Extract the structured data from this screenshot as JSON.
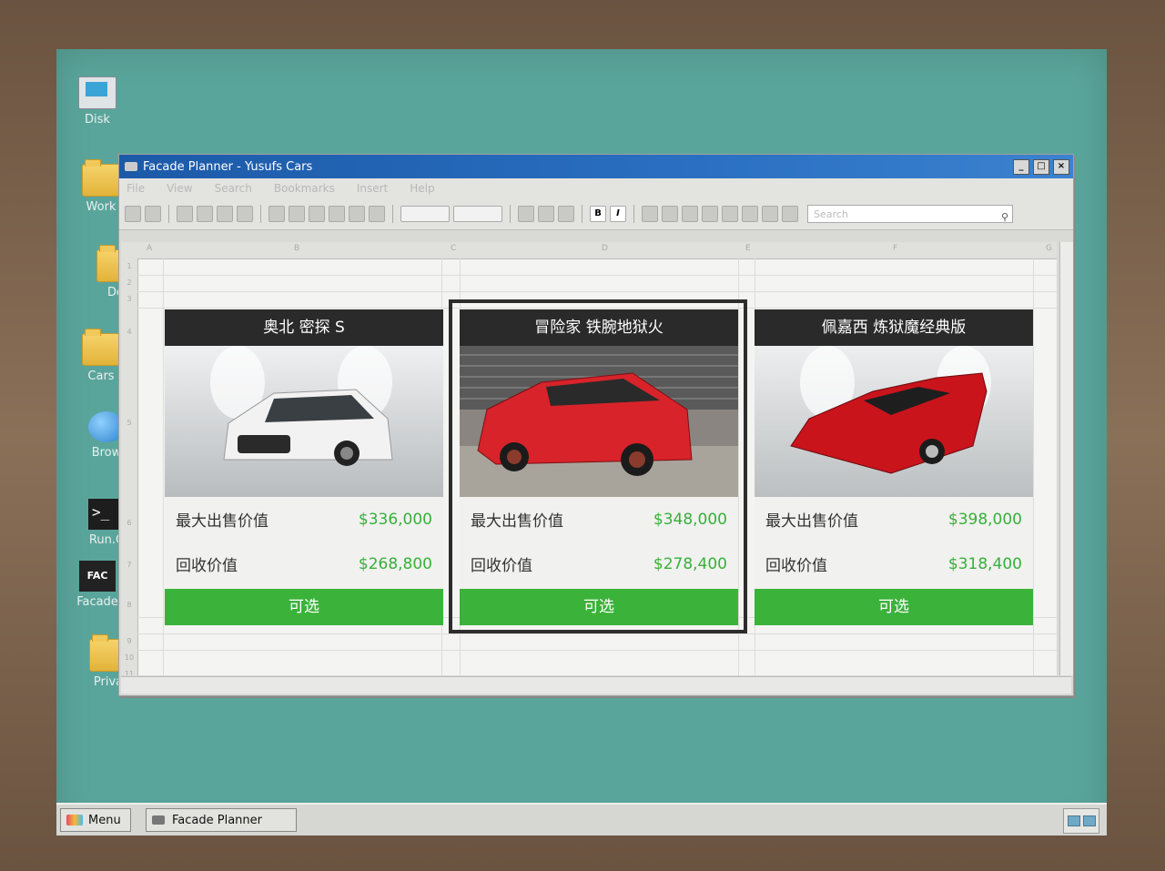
{
  "desktop": {
    "icons": [
      {
        "label": "Disk",
        "icon": "computer-icon"
      },
      {
        "label": "Work",
        "icon": "folder-icon"
      },
      {
        "label": "Do",
        "icon": "folder-icon"
      },
      {
        "label": "Cars",
        "icon": "folder-icon"
      },
      {
        "label": "Brow",
        "icon": "globe-icon"
      },
      {
        "label": "Run.C",
        "icon": "terminal-icon"
      },
      {
        "label": "Facade",
        "icon": "facade-icon"
      },
      {
        "label": "Priva",
        "icon": "folder-icon"
      }
    ],
    "terminal_glyph": ">_",
    "facade_glyph": "FAC"
  },
  "window": {
    "title": "Facade Planner - Yusufs Cars",
    "menu": [
      "File",
      "View",
      "Search",
      "Bookmarks",
      "Insert",
      "Help"
    ],
    "toolbar": {
      "bold_label": "B",
      "italic_label": "I",
      "search_placeholder": "Search"
    },
    "column_headers": [
      "A",
      "B",
      "C",
      "D",
      "E",
      "F",
      "G"
    ],
    "row_headers": [
      "1",
      "2",
      "3",
      "4",
      "5",
      "6",
      "7",
      "8",
      "9",
      "10",
      "11"
    ]
  },
  "cards": [
    {
      "name": "奥北 密探 S",
      "max_sale_label": "最大出售价值",
      "max_sale_value": "$336,000",
      "trade_in_label": "回收价值",
      "trade_in_value": "$268,800",
      "status": "可选",
      "car_color": "#f2f2f2"
    },
    {
      "name": "冒险家 铁腕地狱火",
      "max_sale_label": "最大出售价值",
      "max_sale_value": "$348,000",
      "trade_in_label": "回收价值",
      "trade_in_value": "$278,400",
      "status": "可选",
      "car_color": "#d8232a"
    },
    {
      "name": "佩嘉西 炼狱魔经典版",
      "max_sale_label": "最大出售价值",
      "max_sale_value": "$398,000",
      "trade_in_label": "回收价值",
      "trade_in_value": "$318,400",
      "status": "可选",
      "car_color": "#c9141c"
    }
  ],
  "taskbar": {
    "menu_label": "Menu",
    "task_label": "Facade Planner"
  },
  "colors": {
    "desktop": "#5aa59b",
    "accent_green": "#3bb23a",
    "title_bar": "#1c5aa8"
  }
}
